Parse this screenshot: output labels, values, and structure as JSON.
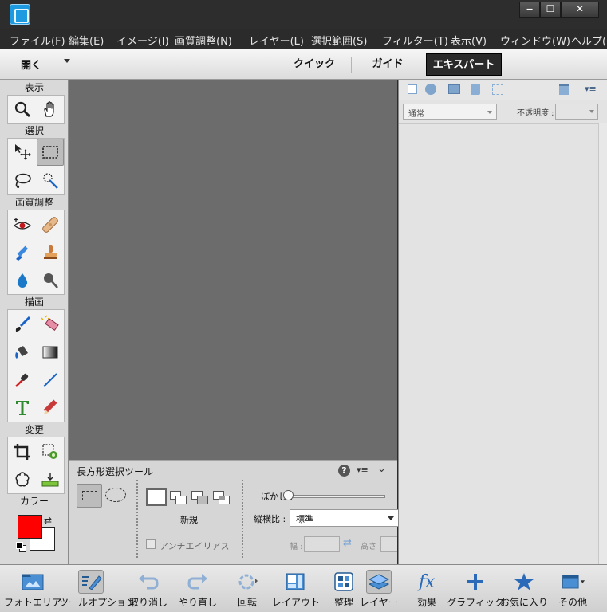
{
  "window": {
    "minimize": "‒",
    "maximize": "☐",
    "close": "✕"
  },
  "menu": [
    "ファイル(F)",
    "編集(E)",
    "イメージ(I)",
    "画質調整(N)",
    "レイヤー(L)",
    "選択範囲(S)",
    "フィルター(T)",
    "表示(V)",
    "ウィンドウ(W)",
    "ヘルプ("
  ],
  "modebar": {
    "open_label": "開く",
    "tabs": [
      "クイック",
      "ガイド",
      "エキスパート"
    ],
    "active_tab": "エキスパート"
  },
  "toolbox": {
    "sections": [
      "表示",
      "選択",
      "画質調整",
      "描画",
      "変更",
      "カラー"
    ],
    "foreground_color": "#ff0000",
    "background_color": "#ffffff"
  },
  "tool_options": {
    "title": "長方形選択ツール",
    "mode_label": "新規",
    "antialias_label": "アンチエイリアス",
    "feather_label": "ぼかし :",
    "aspect_label": "縦横比 :",
    "aspect_value": "標準",
    "width_label": "幅 :",
    "height_label": "高さ :"
  },
  "layers": {
    "blend_mode": "通常",
    "opacity_label": "不透明度 :"
  },
  "taskbar": [
    {
      "label": "フォトエリア"
    },
    {
      "label": "ツールオプション"
    },
    {
      "label": "取り消し"
    },
    {
      "label": "やり直し"
    },
    {
      "label": "回転"
    },
    {
      "label": "レイアウト"
    },
    {
      "label": "整理"
    },
    {
      "label": "レイヤー"
    },
    {
      "label": "効果"
    },
    {
      "label": "グラフィック"
    },
    {
      "label": "お気に入り"
    },
    {
      "label": "その他"
    }
  ]
}
